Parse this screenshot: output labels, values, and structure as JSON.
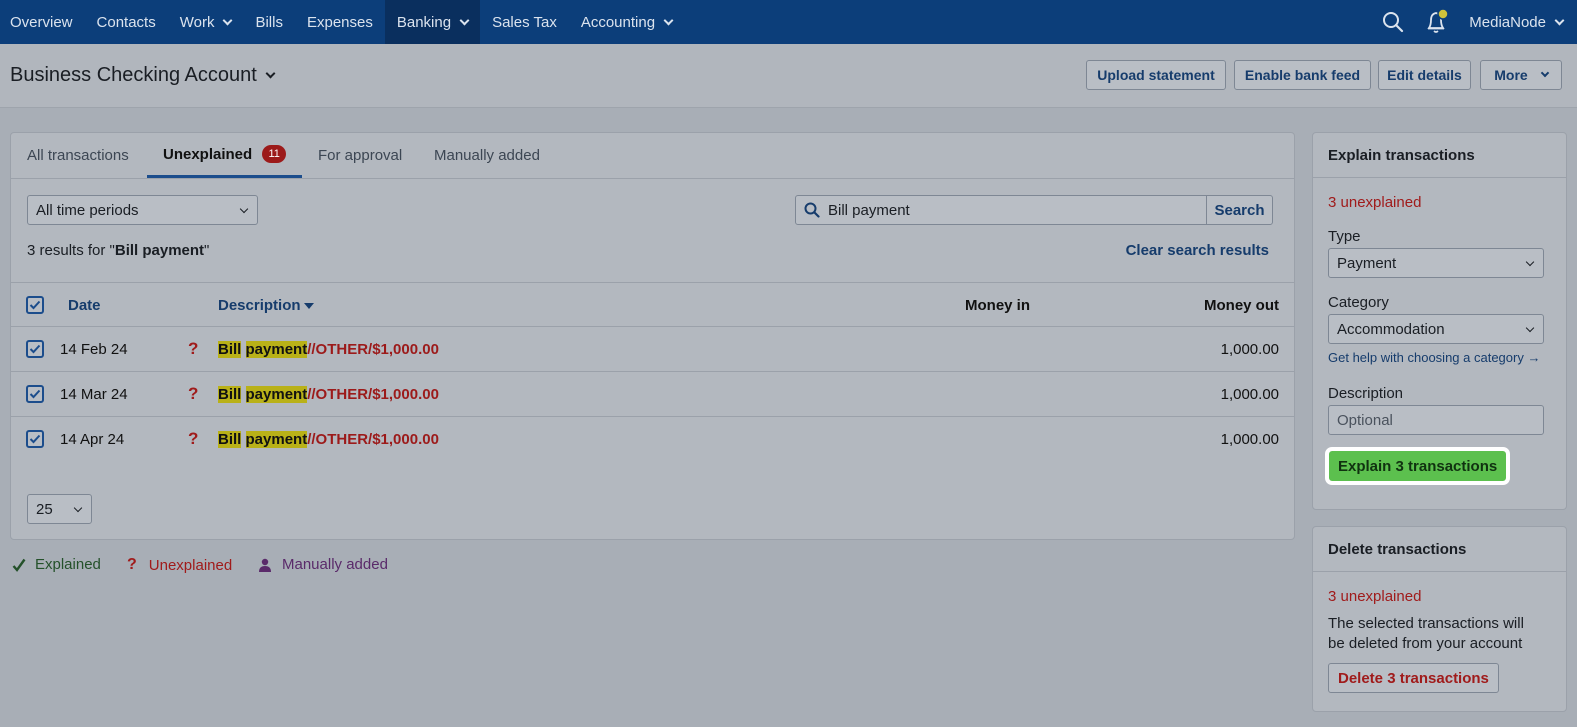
{
  "nav": {
    "items": [
      "Overview",
      "Contacts",
      "Work",
      "Bills",
      "Expenses",
      "Banking",
      "Sales Tax",
      "Accounting"
    ],
    "active": "Banking",
    "user": "MediaNode"
  },
  "header": {
    "title": "Business Checking Account",
    "buttons": {
      "upload": "Upload statement",
      "bank_feed": "Enable bank feed",
      "edit": "Edit details",
      "more": "More"
    }
  },
  "tabs": [
    {
      "label": "All transactions"
    },
    {
      "label": "Unexplained",
      "badge": "11",
      "active": true
    },
    {
      "label": "For approval"
    },
    {
      "label": "Manually added"
    }
  ],
  "filters": {
    "period": "All time periods",
    "search_value": "Bill payment",
    "search_button": "Search"
  },
  "results": {
    "prefix": "3 results for \"",
    "query": "Bill payment",
    "suffix": "\"",
    "clear_link": "Clear search results"
  },
  "table": {
    "columns": {
      "date": "Date",
      "description": "Description",
      "money_in": "Money in",
      "money_out": "Money out"
    },
    "rows": [
      {
        "date": "14 Feb 24",
        "status": "?",
        "desc_hl1": "Bill",
        "desc_hl2": "payment",
        "desc_rest": "//OTHER/$1,000.00",
        "money_in": "",
        "money_out": "1,000.00"
      },
      {
        "date": "14 Mar 24",
        "status": "?",
        "desc_hl1": "Bill",
        "desc_hl2": "payment",
        "desc_rest": "//OTHER/$1,000.00",
        "money_in": "",
        "money_out": "1,000.00"
      },
      {
        "date": "14 Apr 24",
        "status": "?",
        "desc_hl1": "Bill",
        "desc_hl2": "payment",
        "desc_rest": "//OTHER/$1,000.00",
        "money_in": "",
        "money_out": "1,000.00"
      }
    ]
  },
  "pager": {
    "per_page": "25"
  },
  "legend": {
    "explained": "Explained",
    "unexplained": "Unexplained",
    "manual": "Manually added"
  },
  "explain_panel": {
    "title": "Explain transactions",
    "count": "3 unexplained",
    "type_label": "Type",
    "type_value": "Payment",
    "category_label": "Category",
    "category_value": "Accommodation",
    "help_link": "Get help with choosing a category →",
    "description_label": "Description",
    "description_placeholder": "Optional",
    "button": "Explain 3 transactions"
  },
  "delete_panel": {
    "title": "Delete transactions",
    "count": "3 unexplained",
    "text": "The selected transactions will be deleted from your account",
    "button": "Delete 3 transactions"
  },
  "colors": {
    "nav": "#0c3e7a",
    "accent": "#163c6c",
    "danger": "#a01b1b",
    "success": "#5cc04e"
  }
}
